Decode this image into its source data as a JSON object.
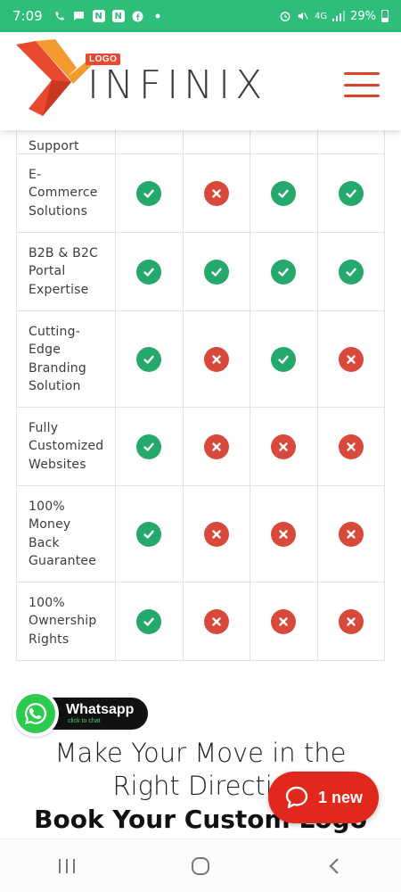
{
  "status_bar": {
    "time": "7:09",
    "battery": "29%",
    "network": "4G"
  },
  "header": {
    "logo_badge": "LOGO",
    "logo_text": "INFINIX",
    "brand_color": "#e8492f"
  },
  "table": {
    "rows": [
      {
        "feature": "Support",
        "marks": []
      },
      {
        "feature": "E-\nCommerce\nSolutions",
        "marks": [
          "yes",
          "no",
          "yes",
          "yes"
        ]
      },
      {
        "feature": "B2B & B2C\nPortal\nExpertise",
        "marks": [
          "yes",
          "yes",
          "yes",
          "yes"
        ]
      },
      {
        "feature": "Cutting-\nEdge\nBranding\nSolution",
        "marks": [
          "yes",
          "no",
          "yes",
          "no"
        ]
      },
      {
        "feature": "Fully\nCustomized\nWebsites",
        "marks": [
          "yes",
          "no",
          "no",
          "no"
        ]
      },
      {
        "feature": "100%\nMoney\nBack\nGuarantee",
        "marks": [
          "yes",
          "no",
          "no",
          "no"
        ]
      },
      {
        "feature": "100%\nOwnership\nRights",
        "marks": [
          "yes",
          "no",
          "no",
          "no"
        ]
      }
    ],
    "yes_color": "#25a86c",
    "no_color": "#d8493b"
  },
  "whatsapp": {
    "title": "Whatsapp",
    "subtitle": "click to chat"
  },
  "headline": {
    "line1": "Make Your Move in the",
    "line2": "Right Directio",
    "line3": "Book Your Custom Logo"
  },
  "chat": {
    "label": "1 new"
  }
}
